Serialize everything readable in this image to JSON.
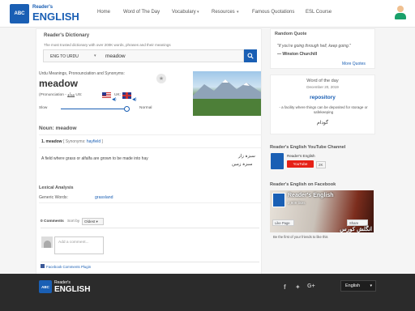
{
  "brand": {
    "small": "Reader's",
    "big": "ENGLISH",
    "logo_badge": "ABC"
  },
  "nav": {
    "home": "Home",
    "word_of_day": "Word of The Day",
    "vocabulary": "Vocabulary",
    "resources": "Resources",
    "quotations": "Famous Quotations",
    "esl": "ESL Course"
  },
  "dict": {
    "title": "Reader's Dictionary",
    "subtitle": "The most trusted dictionary with over 200K words, phrases and their meanings",
    "mode": "ENG TO URDU",
    "query": "meadow"
  },
  "entry": {
    "meta": "Urdu Meanings, Pronounciation and Synonyms:",
    "word": "meadow",
    "pron_prefix": "(Pronunciation -",
    "pron_urdu": "مِیڈو",
    "us": "US:",
    "uk": "UK:",
    "slow": "Slow",
    "normal": "Normal",
    "noun_header": "Noun: meadow",
    "sense_word": "1. meadow",
    "syn_open": "[ Synonyms:",
    "syn": "hayfield",
    "syn_close": "]",
    "definition": "A field where grass or alfalfa are grown to be made into hay",
    "urdu1": "سبزہ زار",
    "urdu2": "سبزہ زمین"
  },
  "lexical": {
    "title": "Lexical Analysis",
    "label": "Generic Words:",
    "value": "grassland"
  },
  "comments": {
    "count": "0 Comments",
    "sort": "Sort by",
    "order": "Oldest",
    "placeholder": "Add a comment...",
    "plugin": "Facebook Comments Plugin"
  },
  "quote": {
    "title": "Random Quote",
    "text": "\"If you're going through hell, keep going.\"",
    "author": "— Winston Churchill",
    "more": "More Quotes"
  },
  "wotd": {
    "title": "Word of the day",
    "date": "December 20, 2019",
    "word": "repository",
    "def": "- a facility where things can be deposited for storage or safekeeping",
    "urdu": "گودام"
  },
  "yt": {
    "title": "Reader's English YouTube Channel",
    "name": "Reader's English",
    "btn": "YouTube",
    "count": "2K"
  },
  "fb": {
    "title": "Reader's English on Facebook",
    "name": "Reader's English",
    "likes": "2,909 likes",
    "like": "Like Page",
    "share": "Share",
    "banner_text": "انگلش کورس",
    "friends": "Be the first of your friends to like this"
  },
  "footer": {
    "lang": "English",
    "fb": "f",
    "tw": "✦",
    "gp": "G+"
  },
  "colors": {
    "brand": "#1a5fb4",
    "youtube": "#e62117",
    "footer": "#2b2b2b"
  }
}
